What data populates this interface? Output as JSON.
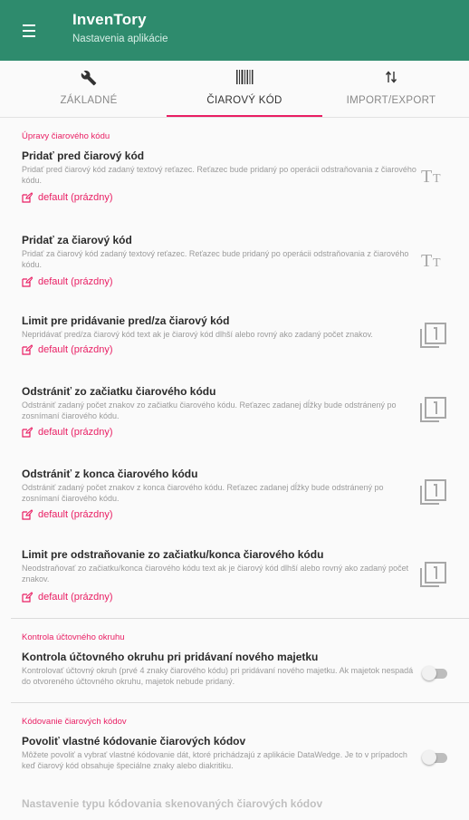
{
  "app": {
    "title": "InvenTory",
    "subtitle": "Nastavenia aplikácie"
  },
  "tabs": [
    {
      "label": "ZÁKLADNÉ",
      "icon": "wrench-icon"
    },
    {
      "label": "ČIAROVÝ KÓD",
      "icon": "barcode-icon",
      "active": true
    },
    {
      "label": "IMPORT/EXPORT",
      "icon": "import-export-icon"
    }
  ],
  "sections": {
    "barcode_edits": "Úpravy čiarového kódu",
    "account_control": "Kontrola účtovného okruhu",
    "barcode_encoding": "Kódovanie čiarových kódov"
  },
  "prefs": {
    "prefix": {
      "title": "Pridať pred čiarový kód",
      "desc": "Pridať pred čiarový kód zadaný textový reťazec. Reťazec bude pridaný po operácii odstraňovania z čiarového kódu.",
      "value": "default (prázdny)"
    },
    "suffix": {
      "title": "Pridať za čiarový kód",
      "desc": "Pridať za čiarový kód zadaný textový reťazec. Reťazec bude pridaný po operácii odstraňovania z čiarového kódu.",
      "value": "default (prázdny)"
    },
    "add_limit": {
      "title": "Limit pre pridávanie pred/za čiarový kód",
      "desc": "Nepridávať pred/za čiarový kód text ak je čiarový kód dlhší alebo rovný ako zadaný počet znakov.",
      "value": "default (prázdny)"
    },
    "strip_start": {
      "title": "Odstrániť zo začiatku čiarového kódu",
      "desc": "Odstrániť zadaný počet znakov zo začiatku čiarového kódu. Reťazec zadanej dĺžky bude odstránený po zosnímaní čiarového kódu.",
      "value": "default (prázdny)"
    },
    "strip_end": {
      "title": "Odstrániť z konca čiarového kódu",
      "desc": "Odstrániť zadaný počet znakov z konca čiarového kódu. Reťazec zadanej dĺžky bude odstránený po zosnímaní čiarového kódu.",
      "value": "default (prázdny)"
    },
    "strip_limit": {
      "title": "Limit pre odstraňovanie zo začiatku/konca čiarového kódu",
      "desc": "Neodstraňovať zo začiatku/konca čiarového kódu text ak je čiarový kód dlhší alebo rovný ako zadaný počet znakov.",
      "value": "default (prázdny)"
    },
    "account_check": {
      "title": "Kontrola účtovného okruhu pri pridávaní nového majetku",
      "desc": "Kontrolovať účtovný okruh (prvé 4 znaky čiarového kódu) pri pridávaní nového majetku. Ak majetok nespadá do otvoreného účtovného okruhu, majetok nebude pridaný.",
      "enabled": false
    },
    "custom_encoding": {
      "title": "Povoliť vlastné kódovanie čiarových kódov",
      "desc": "Môžete povoliť a vybrať vlastné kódovanie dát, ktoré prichádzajú z aplikácie DataWedge. Je to v prípadoch keď čiarový kód obsahuje špeciálne znaky alebo diakritiku.",
      "enabled": false
    },
    "encoding_type": {
      "title": "Nastavenie typu kódovania skenovaných čiarových kódov"
    }
  },
  "colors": {
    "primary": "#2e8b6d",
    "accent": "#e91e63"
  }
}
